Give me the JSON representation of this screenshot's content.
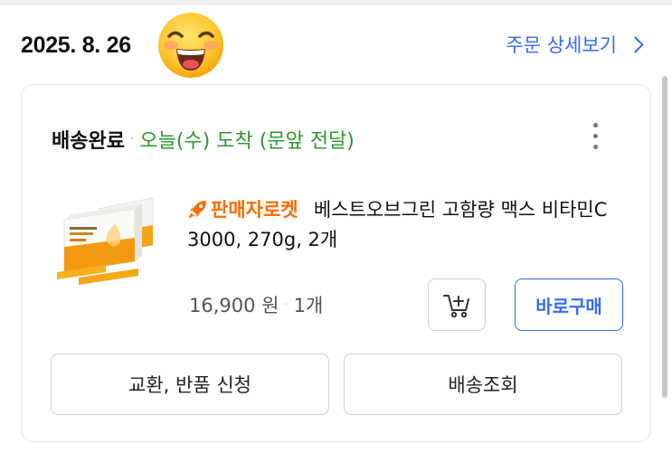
{
  "header": {
    "order_date": "2025. 8. 26",
    "detail_link": "주문 상세보기"
  },
  "order_card": {
    "status": "배송완료",
    "separator": "·",
    "status_detail": "오늘(수) 도착 (문앞 전달)",
    "product": {
      "badge": "판매자로켓",
      "title": "베스트오브그린 고함량 맥스 비타민C 3000, 270g, 2개",
      "price": "16,900 원",
      "quantity": "1개",
      "thumbnail_label": "맥스 비타민C 3000"
    },
    "buttons": {
      "cart_icon": "cart-plus-icon",
      "buy_now": "바로구매",
      "exchange_return": "교환, 반품 신청",
      "track_delivery": "배송조회"
    }
  },
  "colors": {
    "link_blue": "#346aff",
    "status_green": "#2c9a2c",
    "rocket_orange": "#ff6a00"
  }
}
